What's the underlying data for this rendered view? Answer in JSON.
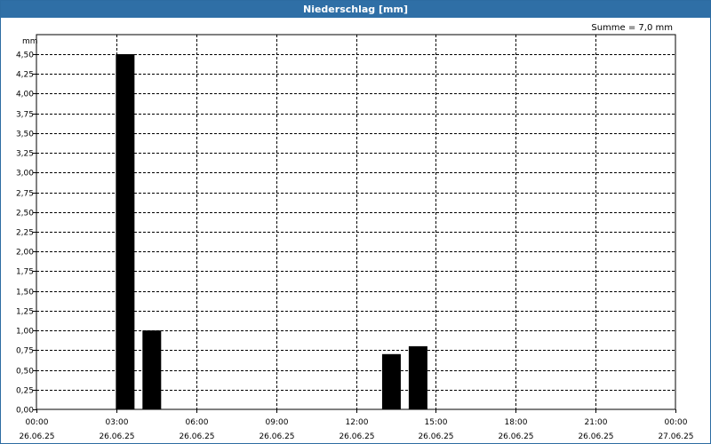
{
  "window": {
    "title": "Niederschlag [mm]"
  },
  "chart_data": {
    "type": "bar",
    "title": "Niederschlag [mm]",
    "annotation": "Summe = 7,0 mm",
    "ylabel": "mm",
    "ylim": [
      0,
      4.5
    ],
    "yticks": [
      "0,00",
      "0,25",
      "0,50",
      "0,75",
      "1,00",
      "1,25",
      "1,50",
      "1,75",
      "2,00",
      "2,25",
      "2,50",
      "2,75",
      "3,00",
      "3,25",
      "3,50",
      "3,75",
      "4,00",
      "4,25",
      "4,50"
    ],
    "x_range_hours": [
      0,
      24
    ],
    "xticks": [
      {
        "time": "00:00",
        "date": "26.06.25"
      },
      {
        "time": "03:00",
        "date": "26.06.25"
      },
      {
        "time": "06:00",
        "date": "26.06.25"
      },
      {
        "time": "09:00",
        "date": "26.06.25"
      },
      {
        "time": "12:00",
        "date": "26.06.25"
      },
      {
        "time": "15:00",
        "date": "26.06.25"
      },
      {
        "time": "18:00",
        "date": "26.06.25"
      },
      {
        "time": "21:00",
        "date": "26.06.25"
      },
      {
        "time": "00:00",
        "date": "27.06.25"
      }
    ],
    "bars": [
      {
        "hour": 3,
        "value": 4.5
      },
      {
        "hour": 4,
        "value": 1.0
      },
      {
        "hour": 13,
        "value": 0.7
      },
      {
        "hour": 14,
        "value": 0.8
      }
    ],
    "grid": true,
    "bar_color": "#000000"
  }
}
